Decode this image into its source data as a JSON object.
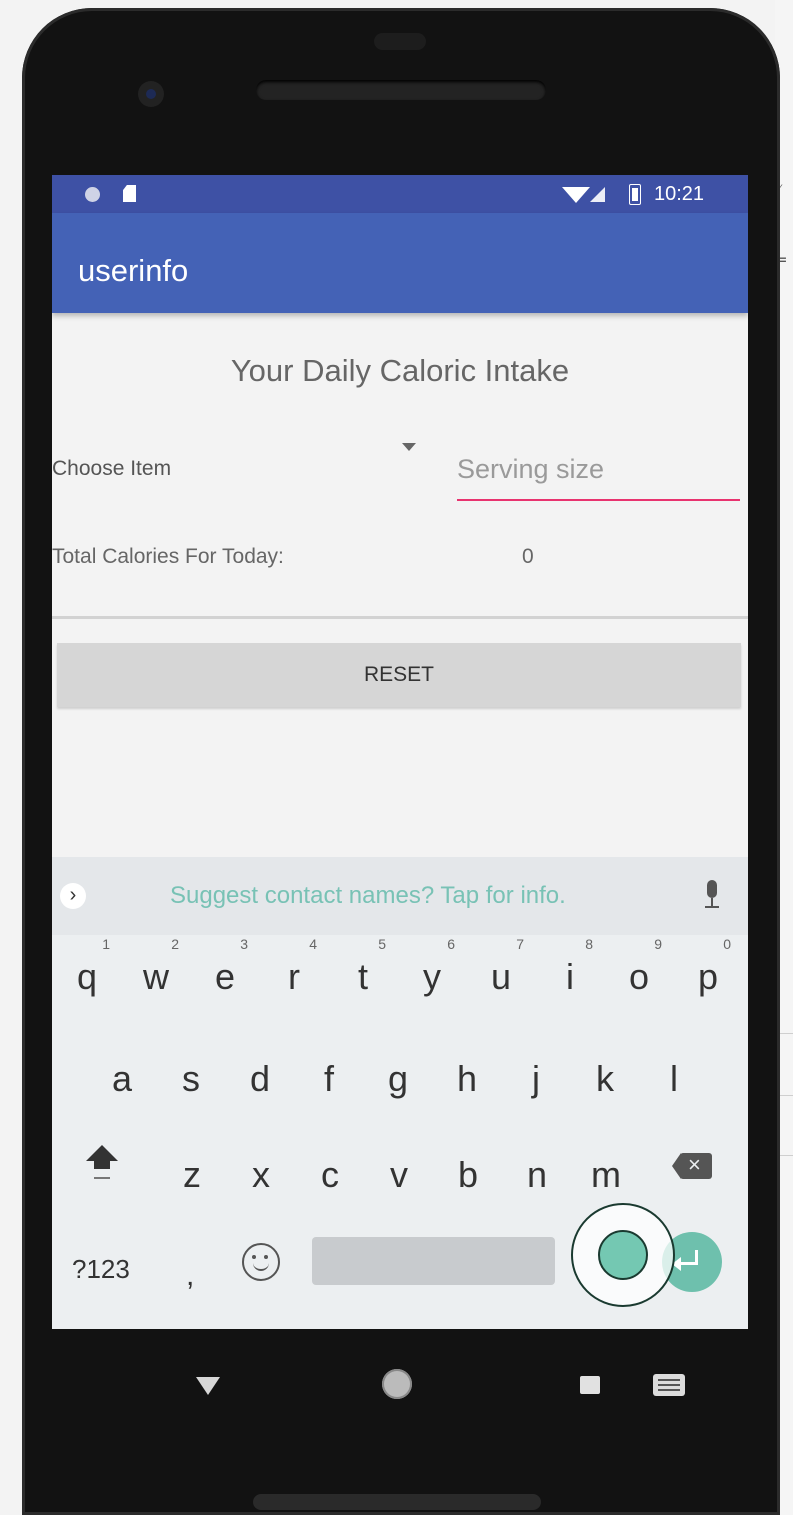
{
  "status_bar": {
    "time": "10:21"
  },
  "app_bar": {
    "title": "userinfo"
  },
  "main": {
    "title": "Your Daily Caloric Intake",
    "spinner_label": "Choose Item",
    "serving_placeholder": "Serving size",
    "total_label": "Total Calories For Today:",
    "total_value": "0",
    "reset_label": "RESET"
  },
  "keyboard": {
    "suggestion_text": "Suggest contact names? Tap for info.",
    "row1": [
      {
        "key": "q",
        "hint": "1"
      },
      {
        "key": "w",
        "hint": "2"
      },
      {
        "key": "e",
        "hint": "3"
      },
      {
        "key": "r",
        "hint": "4"
      },
      {
        "key": "t",
        "hint": "5"
      },
      {
        "key": "y",
        "hint": "6"
      },
      {
        "key": "u",
        "hint": "7"
      },
      {
        "key": "i",
        "hint": "8"
      },
      {
        "key": "o",
        "hint": "9"
      },
      {
        "key": "p",
        "hint": "0"
      }
    ],
    "row2": [
      "a",
      "s",
      "d",
      "f",
      "g",
      "h",
      "j",
      "k",
      "l"
    ],
    "row3": [
      "z",
      "x",
      "c",
      "v",
      "b",
      "n",
      "m"
    ],
    "symbols_label": "?123",
    "comma_label": ",",
    "colors": {
      "suggestion": "#78c2b5",
      "enter_key": "#6ec0ad"
    }
  },
  "icons": {
    "status": [
      "notification-dot-icon",
      "sd-card-icon",
      "wifi-icon",
      "cell-signal-icon",
      "battery-icon"
    ],
    "nav": [
      "back-icon",
      "home-icon",
      "recents-icon",
      "keyboard-switch-icon"
    ]
  },
  "colors": {
    "app_bar": "#4462b6",
    "status_bar": "#3e51a5",
    "input_underline": "#e8336f"
  }
}
